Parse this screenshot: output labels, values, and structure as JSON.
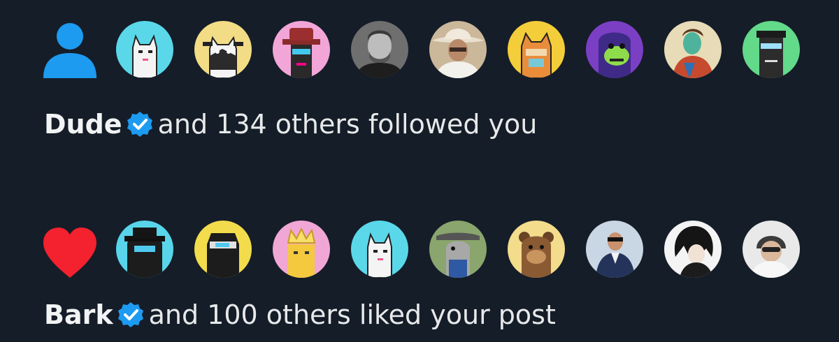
{
  "colors": {
    "background": "#151d28",
    "text": "#e7e9ea",
    "follow_icon": "#1d9bf0",
    "like_icon": "#f4212e",
    "verified_badge": "#1d9bf0"
  },
  "notifications": [
    {
      "type": "follow",
      "icon": "person-icon",
      "actor": "Dude",
      "verified": true,
      "text": "and 134 others followed you",
      "avatars": [
        {
          "name": "cat-avatar-cyan",
          "bg": "#5ad8ea"
        },
        {
          "name": "cat-avatar-yellow",
          "bg": "#f3dc86"
        },
        {
          "name": "cowboy-avatar-pink",
          "bg": "#f2a6d8"
        },
        {
          "name": "man-photo-avatar-bw",
          "bg": "#777777"
        },
        {
          "name": "cowboy-photo-avatar",
          "bg": "#d2c1a8"
        },
        {
          "name": "dog-avatar-yellow",
          "bg": "#f4cd3a"
        },
        {
          "name": "ape-avatar-purple",
          "bg": "#7b3fc4"
        },
        {
          "name": "painted-portrait-avatar",
          "bg": "#e7dcb7"
        },
        {
          "name": "punk-avatar-green",
          "bg": "#63d98a"
        }
      ]
    },
    {
      "type": "like",
      "icon": "heart-icon",
      "actor": "Bark",
      "verified": true,
      "text": "and 100 others liked your post",
      "avatars": [
        {
          "name": "hooded-avatar-cyan",
          "bg": "#58d5ea"
        },
        {
          "name": "ninja-avatar-yellow",
          "bg": "#f3dc4c"
        },
        {
          "name": "king-avatar-pink",
          "bg": "#f1a7d6"
        },
        {
          "name": "cat-avatar-cyan-2",
          "bg": "#5ad8ea"
        },
        {
          "name": "goat-avatar-green",
          "bg": "#8aa56d"
        },
        {
          "name": "bear-avatar-yellow",
          "bg": "#f3dc8c"
        },
        {
          "name": "man-suit-photo-avatar",
          "bg": "#9db5cf"
        },
        {
          "name": "anime-avatar-white",
          "bg": "#f4f4f4"
        },
        {
          "name": "astronaut-avatar-white",
          "bg": "#e9e9e9"
        }
      ]
    }
  ]
}
